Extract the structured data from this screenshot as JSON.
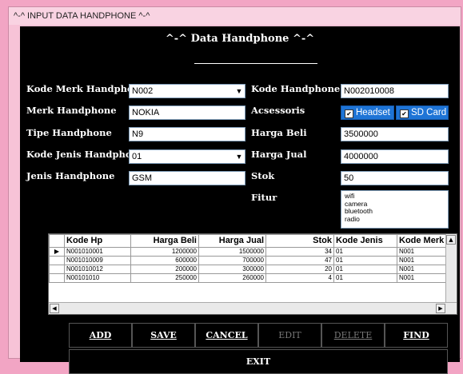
{
  "window": {
    "title": "^-^ INPUT DATA HANDPHONE ^-^"
  },
  "header": {
    "title": "^-^ Data Handphone ^-^"
  },
  "form": {
    "kode_merk": {
      "label": "Kode Merk Handphone",
      "value": "N002"
    },
    "merk": {
      "label": "Merk Handphone",
      "value": "NOKIA"
    },
    "tipe": {
      "label": "Tipe Handphone",
      "value": "N9"
    },
    "kode_jenis": {
      "label": "Kode Jenis Handphone",
      "value": "01"
    },
    "jenis": {
      "label": "Jenis Handphone",
      "value": "GSM"
    },
    "kode_hp": {
      "label": "Kode Handphone",
      "value": "N002010008"
    },
    "acsessoris": {
      "label": "Acsessoris",
      "headset": "Headset",
      "sdcard": "SD Card",
      "headset_checked": true,
      "sdcard_checked": true
    },
    "harga_beli": {
      "label": "Harga Beli",
      "value": "3500000"
    },
    "harga_jual": {
      "label": "Harga Jual",
      "value": "4000000"
    },
    "stok": {
      "label": "Stok",
      "value": "50"
    },
    "fitur": {
      "label": "Fitur",
      "items": [
        "wifi",
        "camera",
        "bluetooth",
        "radio"
      ]
    }
  },
  "grid": {
    "headers": [
      "Kode Hp",
      "Harga Beli",
      "Harga Jual",
      "Stok",
      "Kode Jenis",
      "Kode Merk"
    ],
    "rows": [
      [
        "N001010001",
        "1200000",
        "1500000",
        "34",
        "01",
        "N001"
      ],
      [
        "N001010009",
        "600000",
        "700000",
        "47",
        "01",
        "N001"
      ],
      [
        "N001010012",
        "200000",
        "300000",
        "20",
        "01",
        "N001"
      ],
      [
        "N00101010",
        "250000",
        "260000",
        "4",
        "01",
        "N001"
      ]
    ]
  },
  "buttons": {
    "add": "ADD",
    "save": "SAVE",
    "cancel": "CANCEL",
    "edit": "EDIT",
    "delete": "DELETE",
    "find": "FIND",
    "exit": "EXIT"
  }
}
